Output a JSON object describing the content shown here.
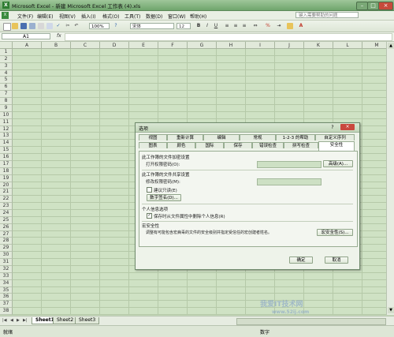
{
  "window": {
    "title": "Microsoft Excel - 新建 Microsoft Excel 工作表 (4).xls",
    "app_icon": "X",
    "minimize": "–",
    "restore": "□",
    "close": "×"
  },
  "menu": {
    "items": [
      "文件(F)",
      "编辑(E)",
      "视图(V)",
      "插入(I)",
      "格式(O)",
      "工具(T)",
      "数据(D)",
      "窗口(W)",
      "帮助(H)"
    ],
    "help_placeholder": "键入需要帮助的问题"
  },
  "toolbar": {
    "zoom": "100%",
    "font": "宋体",
    "size": "12"
  },
  "formula": {
    "cell": "A1",
    "fx": "fx"
  },
  "columns": [
    "A",
    "B",
    "C",
    "D",
    "E",
    "F",
    "G",
    "H",
    "I",
    "J",
    "K",
    "L",
    "M"
  ],
  "rows": [
    "1",
    "2",
    "3",
    "4",
    "5",
    "6",
    "7",
    "8",
    "9",
    "10",
    "11",
    "12",
    "13",
    "14",
    "15",
    "16",
    "17",
    "18",
    "19",
    "20",
    "21",
    "22",
    "23",
    "24",
    "25",
    "26",
    "27",
    "28",
    "29",
    "30",
    "31",
    "32",
    "33",
    "34",
    "35",
    "36",
    "37",
    "38"
  ],
  "sheets": {
    "tabs": [
      "Sheet1",
      "Sheet2",
      "Sheet3"
    ],
    "active": 0
  },
  "status": {
    "ready": "就绪",
    "numlock": "数字"
  },
  "dialog": {
    "title": "选项",
    "help": "?",
    "close": "×",
    "tabs_row1": [
      "视图",
      "重新计算",
      "编辑",
      "常规",
      "1-2-3 的帮助",
      "自定义序列"
    ],
    "tabs_row2": [
      "图表",
      "颜色",
      "国际",
      "保存",
      "错误检查",
      "拼写检查",
      "安全性"
    ],
    "active_tab": "安全性",
    "sec_encrypt": "此工作簿的文件加密设置",
    "open_pwd": "打开权限密码(O):",
    "advanced": "高级(A)...",
    "sec_share": "此工作簿的文件共享设置",
    "modify_pwd": "修改权限密码(M):",
    "readonly": "建议只读(E)",
    "signature": "数字签名(D)...",
    "sec_privacy": "个人信息选项",
    "remove_info": "保存时从文件属性中删除个人信息(R)",
    "sec_macro": "宏安全性",
    "macro_desc": "调整有可能包含宏病毒的文件的安全级别并指定受信任的宏创建者姓名。",
    "macro_btn": "宏安全性(S)...",
    "ok": "确定",
    "cancel": "取消"
  },
  "watermark": {
    "line1": "我爱IT技术网",
    "line2": "www.52ij.com"
  }
}
